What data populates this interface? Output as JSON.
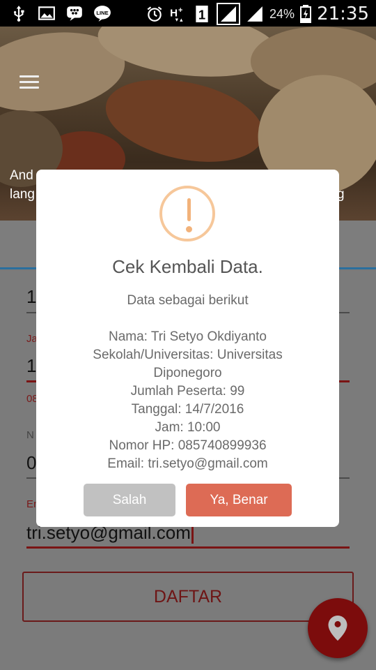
{
  "status_bar": {
    "battery": "24%",
    "time": "21:35",
    "icons": [
      "usb-icon",
      "image-icon",
      "bbm-icon",
      "line-icon",
      "alarm-icon",
      "hplus-icon",
      "sim1-icon",
      "signal-icon",
      "signal2-icon",
      "battery-icon"
    ]
  },
  "hero": {
    "caption_line1": "And",
    "caption_line1_tail": "",
    "caption_line2": "lang",
    "caption_line2_tail": "g"
  },
  "form": {
    "field1_value": "1",
    "field2_label": "Ja",
    "field2_value": "1",
    "field2_hint": "08",
    "field3_label": "N",
    "field3_value": "0",
    "email_label": "Em",
    "email_value": "tri.setyo@gmail.com",
    "submit_label": "DAFTAR"
  },
  "dialog": {
    "title": "Cek Kembali Data.",
    "subtitle": "Data sebagai berikut",
    "lines": [
      "Nama: Tri Setyo Okdiyanto",
      "Sekolah/Universitas: Universitas",
      "Diponegoro",
      "Jumlah Peserta: 99",
      "Tanggal: 14/7/2016",
      "Jam: 10:00",
      "Nomor HP: 085740899936",
      "Email: tri.setyo@gmail.com"
    ],
    "cancel_label": "Salah",
    "confirm_label": "Ya, Benar"
  },
  "colors": {
    "confirm": "#dd6b55",
    "cancel": "#c1c1c1",
    "accent_red": "#7c0c0c",
    "warning": "#f2b27a"
  }
}
